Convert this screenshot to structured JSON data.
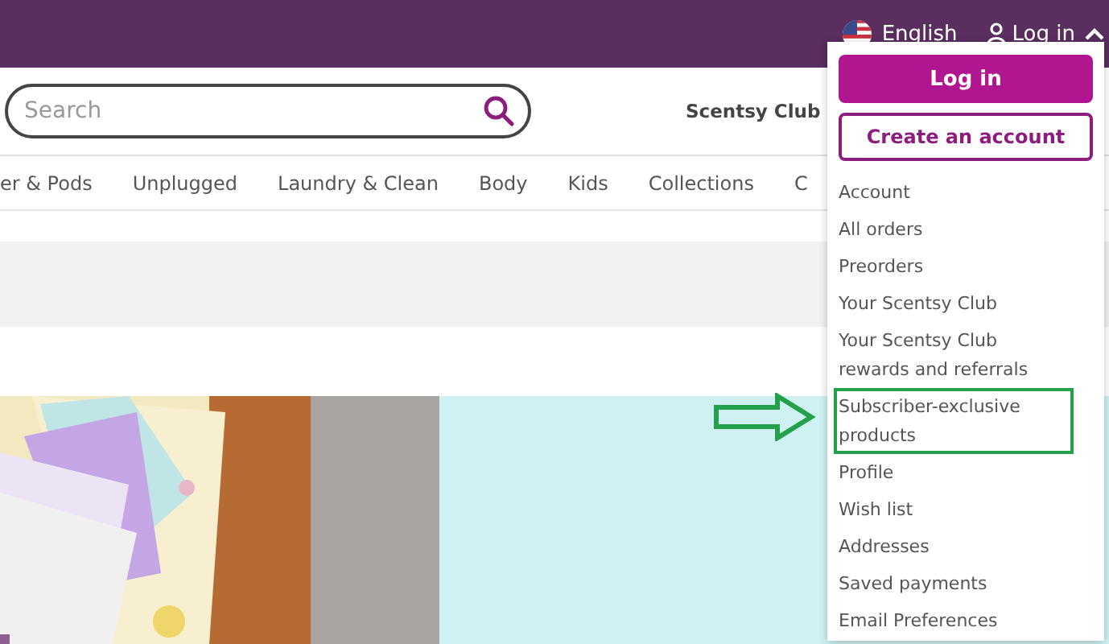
{
  "top_bar": {
    "language": "English",
    "login_link": "Log in"
  },
  "search": {
    "placeholder": "Search"
  },
  "header_links": [
    "Scentsy Club"
  ],
  "nav": [
    "er & Pods",
    "Unplugged",
    "Laundry & Clean",
    "Body",
    "Kids",
    "Collections",
    "C"
  ],
  "account_menu": {
    "expanded": true,
    "primary_button": "Log in",
    "secondary_button": "Create an account",
    "items": [
      {
        "label": "Account",
        "highlighted": false
      },
      {
        "label": "All orders",
        "highlighted": false
      },
      {
        "label": "Preorders",
        "highlighted": false
      },
      {
        "label": "Your Scentsy Club",
        "highlighted": false
      },
      {
        "label": "Your Scentsy Club rewards and referrals",
        "highlighted": false
      },
      {
        "label": "Subscriber-exclusive products",
        "highlighted": true
      },
      {
        "label": "Profile",
        "highlighted": false
      },
      {
        "label": "Wish list",
        "highlighted": false
      },
      {
        "label": "Addresses",
        "highlighted": false
      },
      {
        "label": "Saved payments",
        "highlighted": false
      },
      {
        "label": "Email Preferences",
        "highlighted": false
      }
    ]
  }
}
